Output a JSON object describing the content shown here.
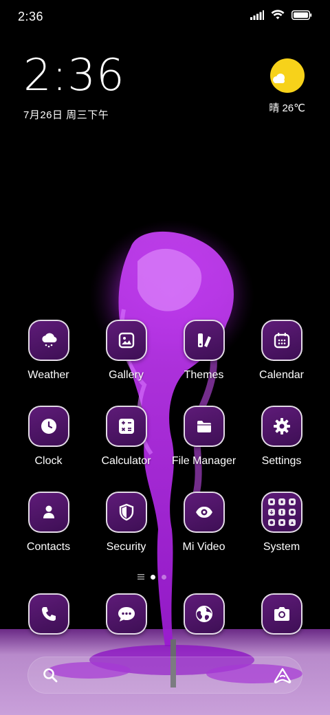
{
  "status_bar": {
    "time": "2:36",
    "icons": [
      "cellular-signal-icon",
      "wifi-icon",
      "battery-icon"
    ]
  },
  "clock_widget": {
    "time": "2:36",
    "date": "7月26日 周三下午"
  },
  "weather_widget": {
    "icon": "sunny-partly-cloudy-icon",
    "text": "晴 26℃"
  },
  "apps": [
    {
      "label": "Weather",
      "icon": "weather-icon"
    },
    {
      "label": "Gallery",
      "icon": "gallery-icon"
    },
    {
      "label": "Themes",
      "icon": "themes-icon"
    },
    {
      "label": "Calendar",
      "icon": "calendar-icon"
    },
    {
      "label": "Clock",
      "icon": "clock-icon"
    },
    {
      "label": "Calculator",
      "icon": "calculator-icon"
    },
    {
      "label": "File Manager",
      "icon": "folder-icon"
    },
    {
      "label": "Settings",
      "icon": "gear-icon"
    },
    {
      "label": "Contacts",
      "icon": "person-icon"
    },
    {
      "label": "Security",
      "icon": "shield-icon"
    },
    {
      "label": "Mi Video",
      "icon": "eye-icon"
    },
    {
      "label": "System",
      "icon": "folder-grid-icon"
    }
  ],
  "page_indicator": {
    "pages": 2,
    "current": 1
  },
  "dock": [
    {
      "icon": "phone-icon"
    },
    {
      "icon": "messages-icon"
    },
    {
      "icon": "browser-icon"
    },
    {
      "icon": "camera-icon"
    }
  ],
  "search_bar": {
    "icons": [
      "search-icon",
      "assistant-icon"
    ]
  },
  "colors": {
    "icon_bg": "#4a1364",
    "accent_purple": "#b326e6",
    "sun_yellow": "#f7d21a"
  }
}
